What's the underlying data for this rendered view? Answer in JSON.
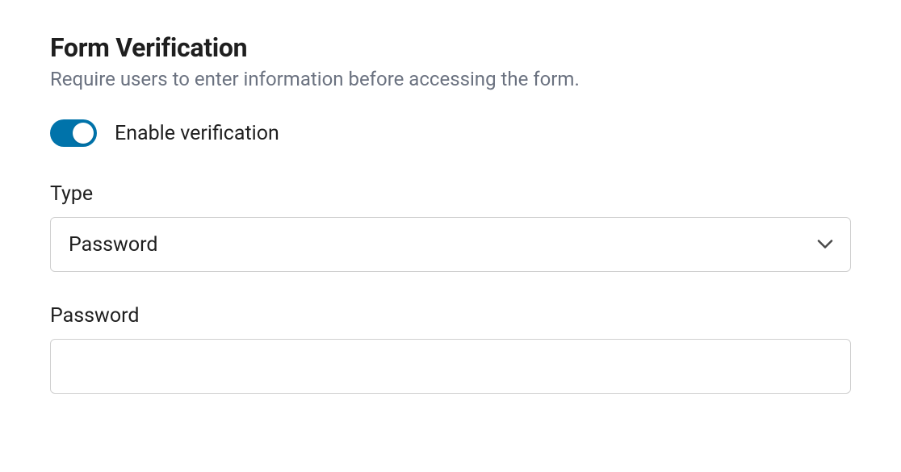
{
  "header": {
    "title": "Form Verification",
    "description": "Require users to enter information before accessing the form."
  },
  "verification": {
    "toggle_label": "Enable verification",
    "enabled": true
  },
  "fields": {
    "type": {
      "label": "Type",
      "selected": "Password"
    },
    "password": {
      "label": "Password",
      "value": ""
    }
  },
  "colors": {
    "toggle_on": "#0073aa",
    "text_primary": "#1f1f1f",
    "text_secondary": "#6b7280",
    "border": "#d0d0d0"
  }
}
